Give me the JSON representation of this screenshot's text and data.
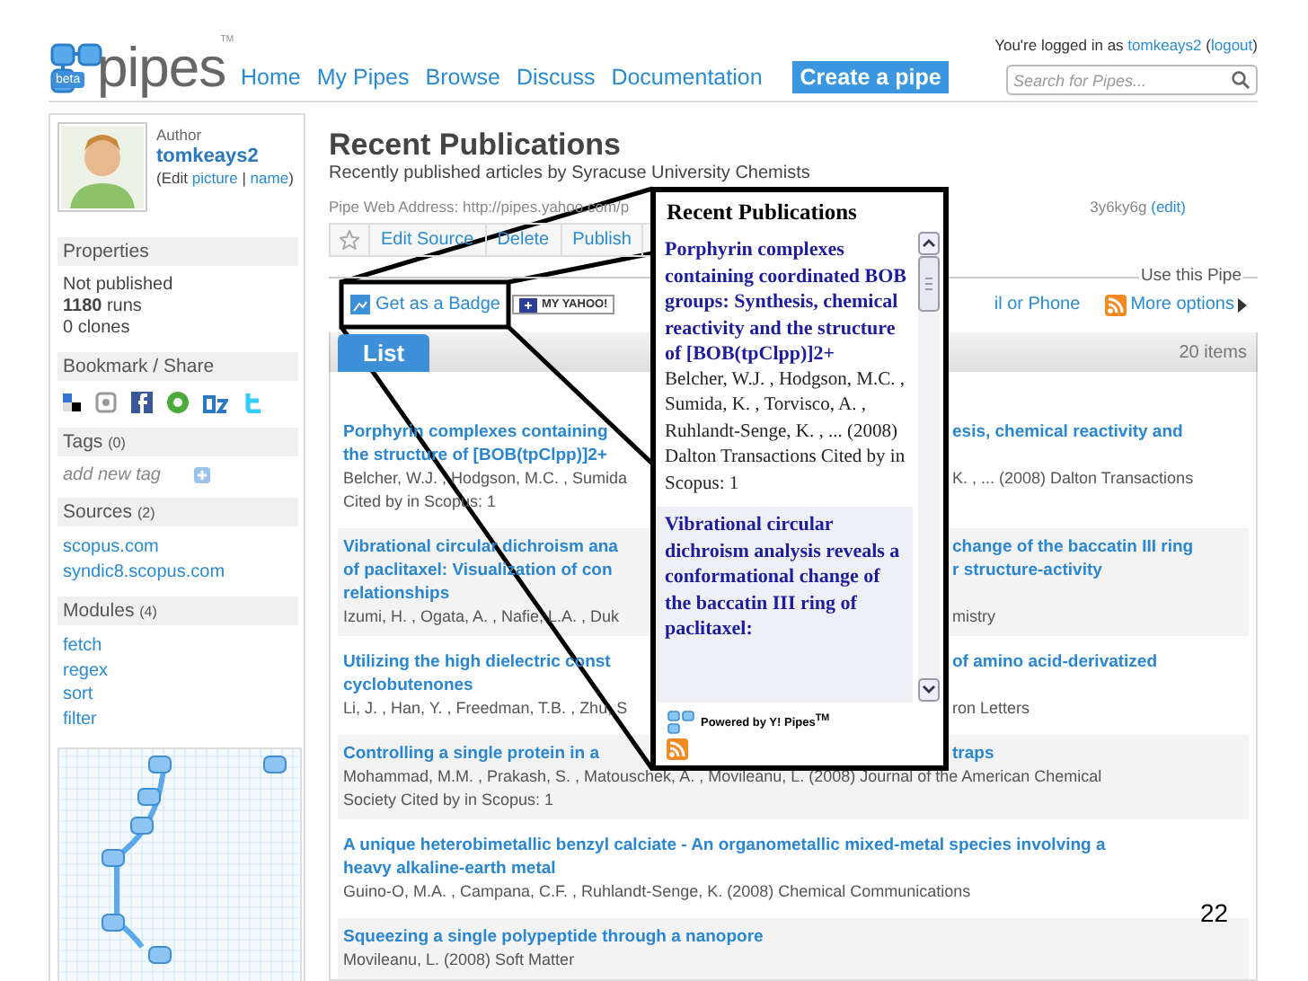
{
  "header": {
    "logo": {
      "text": "pipes",
      "badge": "beta",
      "tm": "TM"
    },
    "nav": [
      {
        "label": "Home"
      },
      {
        "label": "My Pipes"
      },
      {
        "label": "Browse"
      },
      {
        "label": "Discuss"
      },
      {
        "label": "Documentation"
      }
    ],
    "create_button": "Create a pipe",
    "login": {
      "prefix": "You're logged in as",
      "user": "tomkeays2",
      "open": "(",
      "logout": "logout",
      "close": ")"
    },
    "search": {
      "placeholder": "Search for Pipes..."
    }
  },
  "sidebar": {
    "author": {
      "label": "Author",
      "name": "tomkeays2",
      "edit": {
        "before": "(Edit",
        "links": [
          "picture",
          "name"
        ],
        "separator": "|",
        "after": ")"
      }
    },
    "sections": [
      {
        "kind": "properties",
        "title": "Properties",
        "lines": [
          "Not published",
          "**1180** runs",
          "0 clones"
        ]
      },
      {
        "kind": "share",
        "title": "Bookmark / Share"
      },
      {
        "kind": "tags",
        "title": "Tags",
        "count": "(0)",
        "add_tag": "add new tag"
      },
      {
        "kind": "links",
        "title": "Sources",
        "count": "(2)",
        "links": [
          "scopus.com",
          "syndic8.scopus.com"
        ]
      },
      {
        "kind": "links",
        "title": "Modules",
        "count": "(4)",
        "links": [
          "fetch",
          "regex",
          "sort",
          "filter"
        ]
      },
      {
        "kind": "diagram"
      }
    ]
  },
  "main": {
    "title": "Recent Publications",
    "subtitle": "Recently published articles by Syracuse University Chemists",
    "address": {
      "left": "Pipe Web Address: http://pipes.yahoo.com/p",
      "right": "3y6ky6g",
      "edit": "(edit)"
    },
    "toolbar": [
      "Edit Source",
      "Delete",
      "Publish"
    ],
    "use_pipe": {
      "legend": "Use this Pipe",
      "badge": "Get as a Badge",
      "my_yahoo": "MY YAHOO!",
      "phone": "il or Phone",
      "more": "More options"
    },
    "tabs": [
      {
        "label": "List",
        "selected": true
      }
    ],
    "count": "20 items",
    "items": [
      {
        "lines": [
          {
            "kind": "title",
            "left": "Porphyrin complexes containing",
            "right": "esis, chemical reactivity and"
          },
          {
            "kind": "title",
            "left": "the structure of [BOB(tpClpp)]2+"
          },
          {
            "kind": "meta",
            "left": "Belcher, W.J. , Hodgson, M.C. , Sumida",
            "right": "K. , ... (2008) Dalton Transactions"
          },
          {
            "kind": "meta",
            "left": "Cited by in Scopus: 1"
          }
        ]
      },
      {
        "lines": [
          {
            "kind": "title",
            "left": "Vibrational circular dichroism ana",
            "right": "change of the baccatin III ring"
          },
          {
            "kind": "title",
            "left": "of paclitaxel: Visualization of con",
            "right": "r structure-activity"
          },
          {
            "kind": "title",
            "left": "relationships"
          },
          {
            "kind": "meta",
            "left": "Izumi, H. , Ogata, A. , Nafie, L.A. , Duk",
            "right": "mistry"
          }
        ]
      },
      {
        "lines": [
          {
            "kind": "title",
            "left": "Utilizing the high dielectric const",
            "right": "of amino acid-derivatized"
          },
          {
            "kind": "title",
            "left": "cyclobutenones"
          },
          {
            "kind": "meta",
            "left": "Li, J. , Han, Y. , Freedman, T.B. , Zhu, S",
            "right": "ron Letters"
          }
        ]
      },
      {
        "lines": [
          {
            "kind": "title",
            "left": "Controlling a single protein in a",
            "right": "traps"
          },
          {
            "kind": "meta",
            "left": "Mohammad, M.M. , Prakash, S. , Matouschek, A. , Movileanu, L. (2008) Journal of the American Chemical"
          },
          {
            "kind": "meta",
            "left": "Society Cited by in Scopus: 1"
          }
        ]
      },
      {
        "lines": [
          {
            "kind": "title",
            "left": "A unique heterobimetallic benzyl calciate - An organometallic mixed-metal species involving a"
          },
          {
            "kind": "title",
            "left": "heavy alkaline-earth metal"
          },
          {
            "kind": "meta",
            "left": "Guino-O, M.A. , Campana, C.F. , Ruhlandt-Senge, K. (2008) Chemical Communications"
          }
        ]
      },
      {
        "lines": [
          {
            "kind": "title",
            "left": "Squeezing a single polypeptide through a nanopore"
          },
          {
            "kind": "meta",
            "left": "Movileanu, L. (2008) Soft Matter"
          }
        ]
      }
    ]
  },
  "badge_popup": {
    "title": "Recent Publications",
    "entries": [
      {
        "title": "Porphyrin complexes containing coordinated BOB groups: Synthesis, chemical reactivity and the structure of [BOB(tpClpp)]2+",
        "meta": "Belcher, W.J. , Hodgson, M.C. , Sumida, K. , Torvisco, A. , Ruhlandt-Senge, K. , ... (2008) Dalton Transactions Cited by in Scopus: 1"
      },
      {
        "title": "Vibrational circular dichroism analysis reveals a conformational change of the baccatin III ring of paclitaxel:"
      }
    ],
    "footer": "Powered by Y! Pipes$^{TM}$"
  },
  "slide_number": "22"
}
